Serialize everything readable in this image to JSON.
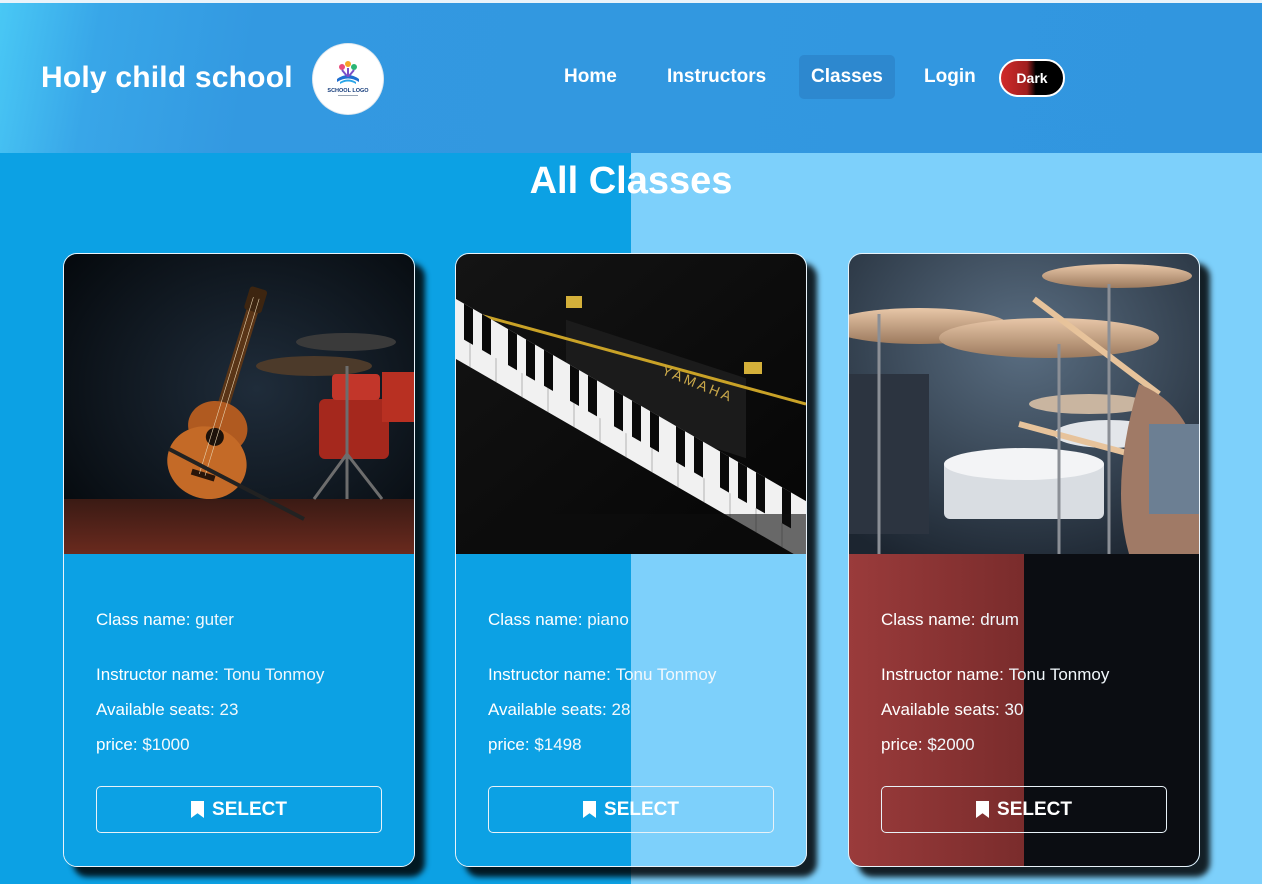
{
  "header": {
    "brand": "Holy child school",
    "logo_text": "SCHOOL LOGO",
    "nav": [
      {
        "label": "Home",
        "active": false
      },
      {
        "label": "Instructors",
        "active": false
      },
      {
        "label": "Classes",
        "active": true
      },
      {
        "label": "Login",
        "active": false
      }
    ],
    "theme_toggle": "Dark"
  },
  "page": {
    "title": "All Classes"
  },
  "labels": {
    "class_name": "Class name:",
    "instructor_name": "Instructor name:",
    "available_seats": "Available seats:",
    "price": "price:",
    "select": "SELECT"
  },
  "classes": [
    {
      "class_name": "guter",
      "instructor": "Tonu Tonmoy",
      "seats": "23",
      "price": "$1000",
      "image": "acoustic-guitar-on-stage"
    },
    {
      "class_name": "piano",
      "instructor": "Tonu Tonmoy",
      "seats": "28",
      "price": "$1498",
      "image": "yamaha-piano-keys"
    },
    {
      "class_name": "drum",
      "instructor": "Tonu Tonmoy",
      "seats": "30",
      "price": "$2000",
      "image": "drummer-drum-kit"
    }
  ],
  "colors": {
    "page_bg_left": "#0ca1e4",
    "page_bg_right": "#7dd0fb",
    "header_bg": "#3196df",
    "active_nav_bg": "#2d88cf",
    "drum_card_left": "#8e3434",
    "drum_card_right": "#0b0d12"
  }
}
